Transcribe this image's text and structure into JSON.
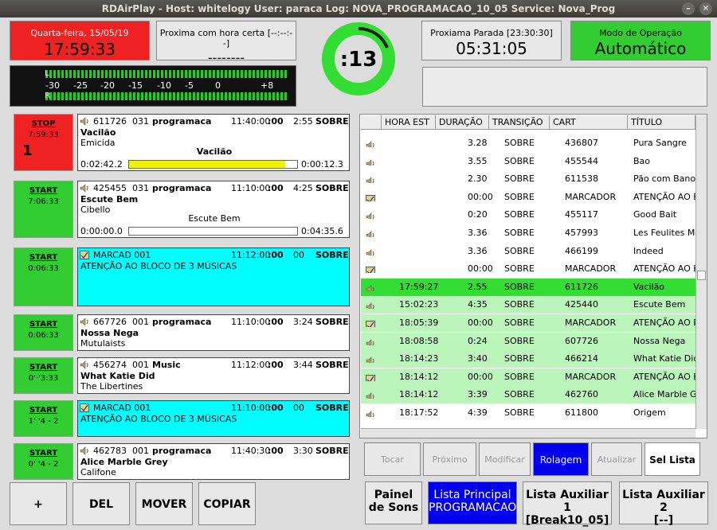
{
  "window": {
    "title": "RDAirPlay - Host: whitelogy  User: paraca  Log: NOVA_PROGRAMACAO_10_05  Service: Nova_Prog"
  },
  "clock": {
    "date": "Quarta-feira, 15/05/19",
    "time": "17:59:33"
  },
  "next_hard": {
    "label": "Proxima com hora certa [--:--:--]",
    "value": "--------"
  },
  "countdown": {
    "value": ":13"
  },
  "next_stop": {
    "label": "Proxiama Parada [23:30:30]",
    "value": "05:31:05"
  },
  "mode": {
    "label": "Modo de Operação",
    "value": "Automático"
  },
  "meter": {
    "l": "L",
    "r": "R",
    "scale": [
      "-30",
      "-25",
      "-20",
      "-15",
      "-10",
      "-5",
      "0",
      "+8"
    ]
  },
  "buttons": [
    {
      "label": "STOP",
      "time": "7:59:33",
      "num": "1"
    },
    {
      "label": "START",
      "time": "7:06:33"
    },
    {
      "label": "START",
      "time": "0:06:33"
    },
    {
      "label": "START",
      "time": "0:06:33"
    },
    {
      "label": "START",
      "time": "0'·'3:33"
    },
    {
      "label": "START",
      "time": "1' '4 - 2"
    },
    {
      "label": "START",
      "time": "0' '4 - 2"
    }
  ],
  "cards": [
    {
      "cart": "611726",
      "cut": "031",
      "group": "programaca",
      "sched": "11:40:00",
      "tr": ":00",
      "len": "2:55",
      "trans": "SOBRE",
      "title": "Vacilão",
      "artist": "Emicida",
      "center": "Vacilão",
      "elapsed": "0:02:42.2",
      "remain": "0:00:12.3",
      "progress": 0.93
    },
    {
      "cart": "425455",
      "cut": "031",
      "group": "programaca",
      "sched": "11:10:00",
      "tr": ":00",
      "len": "4:25",
      "trans": "SOBRE",
      "title": "Escute Bem",
      "artist": "Cibello",
      "center": "Escute Bem",
      "elapsed": "0:00:00.0",
      "remain": "0:04:35.6",
      "progress": 0.0
    },
    {
      "cart": "MARCAD 001",
      "sched": "11:12:00",
      "tr": ":00",
      "len": "00",
      "trans": "SOBRE",
      "note": "ATENÇÃO AO BLOCO DE 3 MÚSICAS"
    },
    {
      "cart": "667726",
      "cut": "001",
      "group": "programaca",
      "sched": "11:10:00",
      "tr": ":00",
      "len": "3:24",
      "trans": "SOBRE",
      "title": "Nossa Nega",
      "artist": "Mutulaists"
    },
    {
      "cart": "456274",
      "cut": "001",
      "group": "Music",
      "sched": "11:12:00",
      "tr": ":00",
      "len": "3:44",
      "trans": "SOBRE",
      "title": "What Katie Did",
      "artist": "The Libertines"
    },
    {
      "cart": "MARCAD 001",
      "sched": "11:10:00",
      "tr": ":00",
      "len": "00",
      "trans": "SOBRE",
      "note": "ATENÇÃO AO BLOCO DE 3 MÚSICAS"
    },
    {
      "cart": "462783",
      "cut": "001",
      "group": "programaca",
      "sched": "11:40:30",
      "tr": ":00",
      "len": "3:30",
      "trans": "SOBRE",
      "title": "Alice Marble Grey",
      "artist": "Califone"
    }
  ],
  "table": {
    "headers": [
      "HORA EST",
      "DURAÇÃO",
      "TRANSIÇÃO",
      "CART",
      "TÍTULO"
    ],
    "rows": [
      {
        "icon": "speaker",
        "hora": "",
        "dur": "3.28",
        "trans": "SOBRE",
        "cart": "436807",
        "title": "Pura Sangre",
        "state": "normal"
      },
      {
        "icon": "speaker",
        "hora": "",
        "dur": "3.55",
        "trans": "SOBRE",
        "cart": "455544",
        "title": "Bao",
        "state": "normal"
      },
      {
        "icon": "speaker",
        "hora": "",
        "dur": "2.30",
        "trans": "SOBRE",
        "cart": "611538",
        "title": "Pão com Banon",
        "state": "normal"
      },
      {
        "icon": "note",
        "hora": "",
        "dur": "00:00",
        "trans": "SOBRE",
        "cart": "MARCADOR",
        "title": "ATENÇÃO AO B",
        "state": "normal"
      },
      {
        "icon": "speaker",
        "hora": "",
        "dur": "0:20",
        "trans": "SOBRE",
        "cart": "455117",
        "title": "Good Bait",
        "state": "normal"
      },
      {
        "icon": "speaker",
        "hora": "",
        "dur": "3.36",
        "trans": "SOBRE",
        "cart": "457993",
        "title": "Les Feulites Mou",
        "state": "normal"
      },
      {
        "icon": "speaker",
        "hora": "",
        "dur": "3.36",
        "trans": "SOBRE",
        "cart": "466199",
        "title": "Indeed",
        "state": "normal"
      },
      {
        "icon": "note",
        "hora": "",
        "dur": "00:00",
        "trans": "SOBRE",
        "cart": "MARCADOR",
        "title": "ATENÇÃO AO B",
        "state": "normal"
      },
      {
        "icon": "speaker",
        "hora": "17:59:27",
        "dur": "2.55",
        "trans": "SOBRE",
        "cart": "611726",
        "title": "Vacilão",
        "state": "playing"
      },
      {
        "icon": "speaker",
        "hora": "15:02:23",
        "dur": "4:35",
        "trans": "SOBRE",
        "cart": "425440",
        "title": "Escute Bem",
        "state": "next"
      },
      {
        "icon": "note",
        "hora": "18:05:39",
        "dur": "00:00",
        "trans": "SOBRE",
        "cart": "MARCADOR",
        "title": "ATENÇÃO AO B",
        "state": "next"
      },
      {
        "icon": "speaker",
        "hora": "18:08:58",
        "dur": "0:24",
        "trans": "SOBRE",
        "cart": "607726",
        "title": "Nossa Nega",
        "state": "next"
      },
      {
        "icon": "speaker",
        "hora": "18:14:23",
        "dur": "3:40",
        "trans": "SOBRE",
        "cart": "466214",
        "title": "What Katie Did",
        "state": "next"
      },
      {
        "icon": "note",
        "hora": "18:14:12",
        "dur": "00:00",
        "trans": "SOBRE",
        "cart": "MARCADOR",
        "title": "ATENÇÃO AO B",
        "state": "next"
      },
      {
        "icon": "speaker",
        "hora": "18:14:12",
        "dur": "3:39",
        "trans": "SOBRE",
        "cart": "462760",
        "title": "Alice Marble Gre",
        "state": "next"
      },
      {
        "icon": "speaker",
        "hora": "18:17:52",
        "dur": "4:39",
        "trans": "SOBRE",
        "cart": "611800",
        "title": "Origem",
        "state": "normal"
      }
    ]
  },
  "actions": {
    "tocar": "Tocar",
    "proximo": "Próximo",
    "modificar": "Modificar",
    "rolagem": "Rolagem",
    "atualizar": "Atualizar",
    "sel_lista": "Sel Lista"
  },
  "bottom_left": {
    "plus": "+",
    "del": "DEL",
    "mover": "MOVER",
    "copiar": "COPIAR"
  },
  "bottom_right": {
    "painel": [
      "Painel",
      "de Sons"
    ],
    "principal": [
      "Lista Principal",
      "PROGRAMACAO"
    ],
    "aux1": [
      "Lista Auxiliar 1",
      "[Break10_05]"
    ],
    "aux2": [
      "Lista Auxiliar 2",
      "[--]"
    ]
  },
  "colors": {
    "green": "#33cc33",
    "red": "#ee2222",
    "cyan": "#00ffff",
    "blue": "#0000ee",
    "playing": "#33dd33",
    "next": "#bbf5bb"
  }
}
